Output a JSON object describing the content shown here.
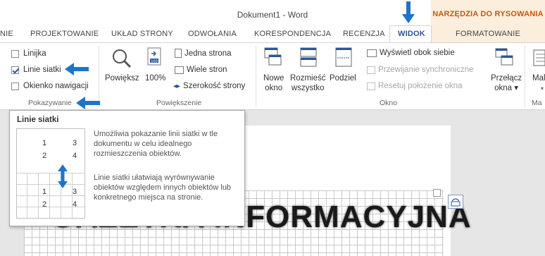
{
  "window": {
    "title": "Dokument1 - Word"
  },
  "context_group": {
    "label": "NARZĘDZIA DO RYSOWANIA"
  },
  "tabs": [
    {
      "label": "NIE"
    },
    {
      "label": "PROJEKTOWANIE"
    },
    {
      "label": "UKŁAD STRONY"
    },
    {
      "label": "ODWOŁANIA"
    },
    {
      "label": "KORESPONDENCJA"
    },
    {
      "label": "RECENZJA"
    },
    {
      "label": "WIDOK",
      "active": true
    },
    {
      "label": "FORMATOWANIE"
    }
  ],
  "show_group": {
    "label": "Pokazywanie",
    "items": [
      {
        "label": "Linijka",
        "checked": false
      },
      {
        "label": "Linie siatki",
        "checked": true
      },
      {
        "label": "Okienko nawigacji",
        "checked": false
      }
    ]
  },
  "zoom_group": {
    "label": "Powiększenie",
    "zoom_label": "Powiększ",
    "zoom100_label": "100%",
    "zoom100_badge": "100",
    "one_page": "Jedna strona",
    "multi_page": "Wiele stron",
    "page_width": "Szerokość strony"
  },
  "window_group": {
    "label": "Okno",
    "new_window": [
      "Nowe",
      "okno"
    ],
    "arrange_all": [
      "Rozmieść",
      "wszystko"
    ],
    "split": "Podziel",
    "side_by_side": "Wyświetl obok siebie",
    "sync_scroll": "Przewijanie synchroniczne",
    "reset_pos": "Resetuj położenie okna",
    "switch_windows": [
      "Przełącz",
      "okna ▾"
    ]
  },
  "macros_group": {
    "label": "Ma",
    "button": "Mal",
    "arrow": "▾"
  },
  "tooltip": {
    "title": "Linie siatki",
    "numbers": [
      "1",
      "3",
      "2",
      "4",
      "1",
      "3",
      "2",
      "4"
    ],
    "description1": "Umożliwia pokazanie linii siatki w tle dokumentu w celu idealnego rozmieszczenia obiektów.",
    "description2": "Linie siatki ułatwiają wyrównywanie obiektów względem innych obiektów lub konkretnego miejsca na stronie."
  },
  "document": {
    "banner_text": "GAZETKA INFORMACYJNA"
  },
  "colors": {
    "accent": "#2b579a",
    "context_tab": "#c55a11",
    "context_bg": "#fbeedc",
    "arrow": "#1e74c8"
  }
}
